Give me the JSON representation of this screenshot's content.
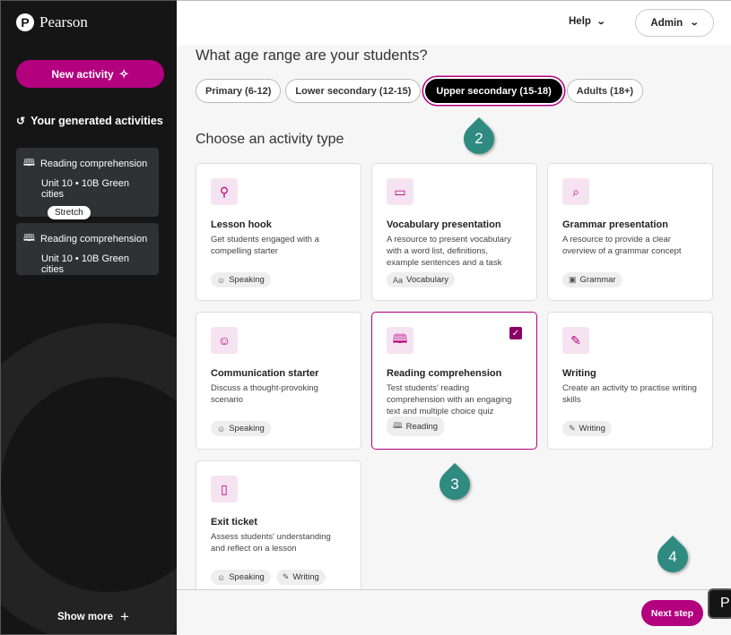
{
  "brand": {
    "logo_letter": "P",
    "name": "Pearson"
  },
  "sidebar": {
    "new_activity_label": "New activity",
    "generated_title": "Your generated activities",
    "items": [
      {
        "title": "Reading comprehension",
        "subtitle": "Unit 10 • 10B Green cities",
        "badge": "Stretch"
      },
      {
        "title": "Reading comprehension",
        "subtitle": "Unit 10 • 10B Green cities"
      }
    ],
    "show_more_label": "Show more"
  },
  "header": {
    "help_label": "Help",
    "admin_label": "Admin"
  },
  "age_section": {
    "title": "What age range are your students?",
    "options": [
      "Primary (6-12)",
      "Lower secondary (12-15)",
      "Upper secondary (15-18)",
      "Adults (18+)"
    ],
    "selected": "Upper secondary (15-18)"
  },
  "activity_section": {
    "title": "Choose an activity type",
    "cards": [
      {
        "icon": "lightbulb-icon",
        "title": "Lesson hook",
        "desc": "Get students engaged with a compelling starter",
        "tags": [
          "Speaking"
        ]
      },
      {
        "icon": "presentation-icon",
        "title": "Vocabulary presentation",
        "desc": "A resource to present vocabulary with a word list, definitions, example sentences and a task",
        "tags": [
          "Vocabulary"
        ]
      },
      {
        "icon": "search-icon",
        "title": "Grammar presentation",
        "desc": "A resource to provide a clear overview of a grammar concept",
        "tags": [
          "Grammar"
        ]
      },
      {
        "icon": "speaking-person-icon",
        "title": "Communication starter",
        "desc": "Discuss a thought-provoking scenario",
        "tags": [
          "Speaking"
        ]
      },
      {
        "icon": "book-icon",
        "title": "Reading comprehension",
        "desc": "Test students' reading comprehension with an engaging text and multiple choice quiz",
        "tags": [
          "Reading"
        ],
        "selected": true
      },
      {
        "icon": "pencil-icon",
        "title": "Writing",
        "desc": "Create an activity to practise writing skills",
        "tags": [
          "Writing"
        ]
      },
      {
        "icon": "exit-door-icon",
        "title": "Exit ticket",
        "desc": "Assess students' understanding and reflect on a lesson",
        "tags": [
          "Speaking",
          "Writing"
        ]
      }
    ]
  },
  "footer": {
    "next_step_label": "Next step"
  },
  "overlay_chip": "P",
  "markers": [
    "2",
    "3",
    "4"
  ],
  "colors": {
    "accent": "#b3007e",
    "sidebar_bg": "#151515",
    "marker": "#2f8a80",
    "check": "#8b0066"
  }
}
